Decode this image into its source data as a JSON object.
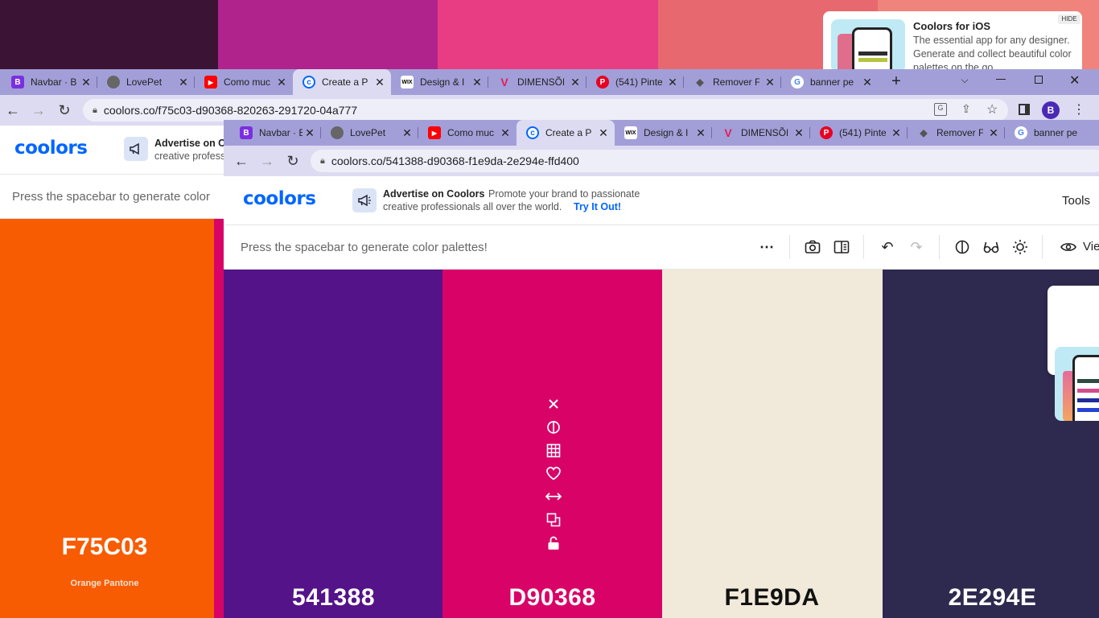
{
  "background_window": {
    "palette_strip_colors": [
      "#3b1435",
      "#b0238c",
      "#e83c83",
      "#e7696f",
      "#f0837b"
    ],
    "tabs": [
      {
        "icon": "bootstrap-icon",
        "title": "Navbar · B"
      },
      {
        "icon": "globe-icon",
        "title": "LovePet"
      },
      {
        "icon": "youtube-icon",
        "title": "Como muc"
      },
      {
        "icon": "coolors-icon",
        "title": "Create a Pa"
      },
      {
        "icon": "wix-icon",
        "title": "Design & I"
      },
      {
        "icon": "vtex-icon",
        "title": "DIMENSÕE"
      },
      {
        "icon": "pinterest-icon",
        "title": "(541) Pinte"
      },
      {
        "icon": "remover-icon",
        "title": "Remover F"
      },
      {
        "icon": "google-icon",
        "title": "banner pe"
      }
    ],
    "url": "coolors.co/f75c03-d90368-820263-291720-04a777",
    "profile_initial": "B",
    "advertise_title": "Advertise on C",
    "advertise_text": "creative profess",
    "toolbar_hint": "Press the spacebar to generate color",
    "visible_color": {
      "hex": "F75C03",
      "name": "Orange Pantone",
      "color": "#f75c03"
    },
    "magenta_sliver_color": "#d90368"
  },
  "ios_ad": {
    "hide_label": "HIDE",
    "title": "Coolors for iOS",
    "text": "The essential app for any designer. Generate and collect beautiful color palettes on the go."
  },
  "front_window": {
    "tabs": [
      {
        "icon": "bootstrap-icon",
        "title": "Navbar · B"
      },
      {
        "icon": "globe-icon",
        "title": "LovePet"
      },
      {
        "icon": "youtube-icon",
        "title": "Como muc"
      },
      {
        "icon": "coolors-icon",
        "title": "Create a Pa"
      },
      {
        "icon": "wix-icon",
        "title": "Design & I"
      },
      {
        "icon": "vtex-icon",
        "title": "DIMENSÕE"
      },
      {
        "icon": "pinterest-icon",
        "title": "(541) Pinte"
      },
      {
        "icon": "remover-icon",
        "title": "Remover F"
      },
      {
        "icon": "google-icon",
        "title": "banner pe"
      }
    ],
    "url": "coolors.co/541388-d90368-f1e9da-2e294e-ffd400",
    "logo": "coolors",
    "advertise_title": "Advertise on Coolors",
    "advertise_text_1": "Promote your brand to passionate",
    "advertise_text_2": "creative professionals all over the world.",
    "advertise_link": "Try It Out!",
    "tools_label": "Tools",
    "toolbar_hint": "Press the spacebar to generate color palettes!",
    "view_label": "View",
    "palette": [
      {
        "hex": "541388",
        "color": "#541388",
        "text_color": "#ffffff"
      },
      {
        "hex": "D90368",
        "color": "#d90368",
        "text_color": "#ffffff"
      },
      {
        "hex": "F1E9DA",
        "color": "#f1e9da",
        "text_color": "#111111"
      },
      {
        "hex": "2E294E",
        "color": "#2e294e",
        "text_color": "#ffffff"
      }
    ],
    "column_actions": [
      "close-icon",
      "contrast-icon",
      "shades-grid-icon",
      "heart-icon",
      "drag-icon",
      "copy-icon",
      "unlock-icon"
    ]
  },
  "colors": {
    "tabbar_bg": "#a29fd8",
    "active_tab_bg": "#dcdbf2",
    "brand_blue": "#0066ff"
  }
}
